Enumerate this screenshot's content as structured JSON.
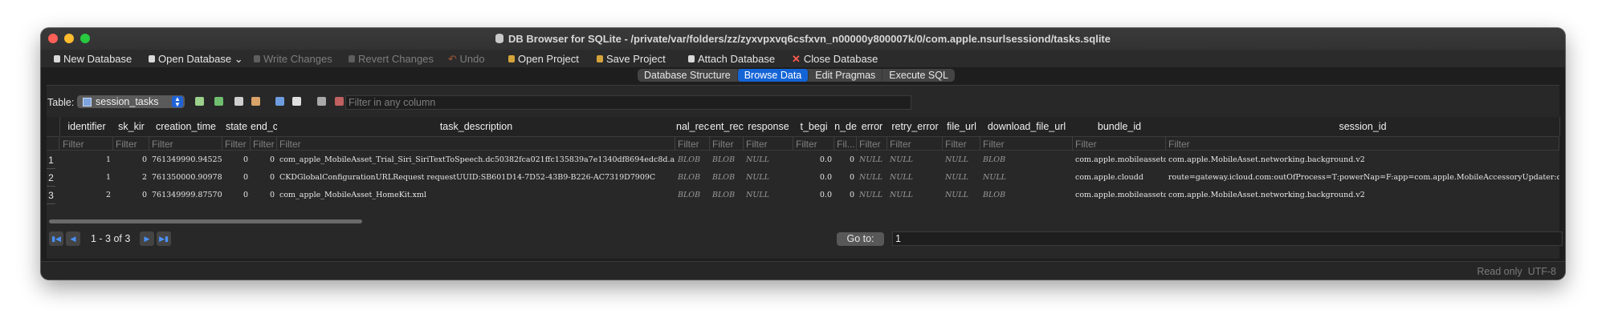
{
  "window": {
    "title": "DB Browser for SQLite - /private/var/folders/zz/zyxvpxvq6csfxvn_n00000y800007k/0/com.apple.nsurlsessiond/tasks.sqlite"
  },
  "toolbar": {
    "new_database": "New Database",
    "open_database": "Open Database",
    "write_changes": "Write Changes",
    "revert_changes": "Revert Changes",
    "undo": "Undo",
    "open_project": "Open Project",
    "save_project": "Save Project",
    "attach_database": "Attach Database",
    "close_database": "Close Database"
  },
  "tabs": [
    "Database Structure",
    "Browse Data",
    "Edit Pragmas",
    "Execute SQL"
  ],
  "table_bar": {
    "label": "Table:",
    "selected_table": "session_tasks",
    "filter_placeholder": "Filter in any column"
  },
  "grid": {
    "columns": [
      "identifier",
      "sk_kir",
      "creation_time",
      "state",
      "end_c",
      "task_description",
      "nal_rec",
      "ent_rec",
      "response",
      "t_begi",
      "n_de",
      "error",
      "retry_error",
      "file_url",
      "download_file_url",
      "bundle_id",
      "session_id"
    ],
    "filters": [
      "Filter",
      "Filter",
      "Filter",
      "Filter",
      "Filter",
      "Filter",
      "Filter",
      "Filter",
      "Filter",
      "Filter",
      "Fil...",
      "Filter",
      "Filter",
      "Filter",
      "Filter",
      "Filter",
      "Filter"
    ],
    "row_numbers": [
      "1",
      "2",
      "3"
    ],
    "rows": [
      [
        "1",
        "0",
        "761349990.945254",
        "0",
        "0",
        "com_apple_MobileAsset_Trial_Siri_SiriTextToSpeech.dc50382fca021ffc135839a7e1340df8694edc8d.a...",
        "BLOB",
        "BLOB",
        "NULL",
        "0.0",
        "0",
        "NULL",
        "NULL",
        "NULL",
        "BLOB",
        "com.apple.mobileassetd",
        "com.apple.MobileAsset.networking.background.v2"
      ],
      [
        "1",
        "2",
        "761350000.909781",
        "0",
        "0",
        "CKDGlobalConfigurationURLRequest requestUUID:SB601D14-7D52-43B9-B226-AC7319D7909C",
        "BLOB",
        "BLOB",
        "NULL",
        "0.0",
        "0",
        "NULL",
        "NULL",
        "NULL",
        "NULL",
        "com.apple.cloudd",
        "route=gateway.icloud.com:outOfProcess=T:powerNap=F:app=com.apple.MobileAccessoryUpdater:disc=T:duet=nc"
      ],
      [
        "2",
        "0",
        "761349999.875705",
        "0",
        "0",
        "com_apple_MobileAsset_HomeKit.xml",
        "BLOB",
        "BLOB",
        "NULL",
        "0.0",
        "0",
        "NULL",
        "NULL",
        "NULL",
        "BLOB",
        "com.apple.mobileassetd",
        "com.apple.MobileAsset.networking.background.v2"
      ]
    ]
  },
  "navigation": {
    "range": "1 - 3 of 3",
    "goto_label": "Go to:",
    "goto_value": "1"
  },
  "status": {
    "read_only": "Read only",
    "encoding": "UTF-8"
  },
  "colors": {
    "accent": "#1464d6",
    "close_red": "#fe5f57",
    "minimize_yellow": "#febc2e",
    "zoom_green": "#28c840"
  }
}
